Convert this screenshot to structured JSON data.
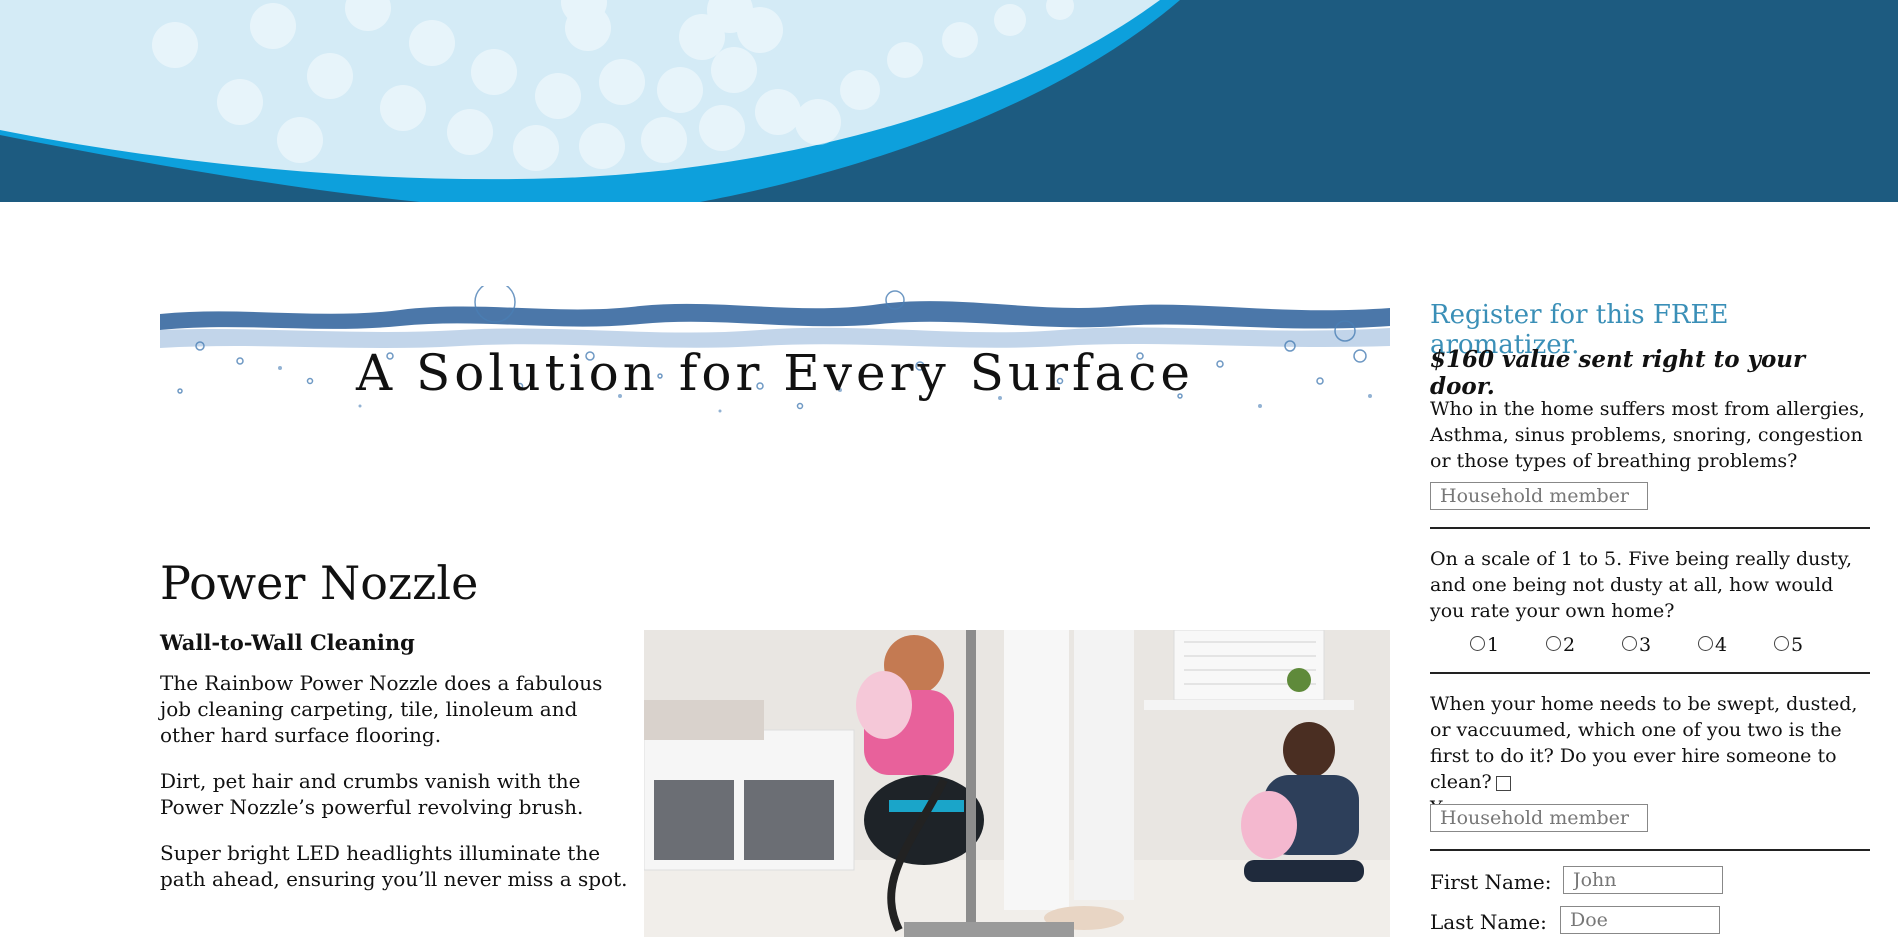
{
  "colors": {
    "header_dark": "#1d5b80",
    "header_bright": "#0da0dc",
    "header_light": "#d4ebf6",
    "heading_accent": "#3a8fb7"
  },
  "banner": {
    "title": "A Solution for Every Surface"
  },
  "product": {
    "title": "Power Nozzle",
    "subtitle": "Wall-to-Wall Cleaning",
    "paragraphs": [
      "The Rainbow Power Nozzle does a fabulous job cleaning carpeting, tile, linoleum and other hard surface flooring.",
      "Dirt, pet hair and crumbs vanish with the Power Nozzle’s powerful revolving brush.",
      "Super bright LED headlights illuminate the path ahead, ensuring you’ll never miss a spot."
    ]
  },
  "form": {
    "heading": "Register for this FREE aromatizer.",
    "subheading": "$160 value sent right to your door.",
    "q1": "Who in the home suffers most from allergies, Asthma, sinus problems, snoring, congestion or those types of breathing problems?",
    "q1_placeholder": "Household member",
    "q2": "On a scale of 1 to 5. Five being really dusty, and one being not dusty at all, how would you rate your own home?",
    "q2_options": [
      "1",
      "2",
      "3",
      "4",
      "5"
    ],
    "q3": "When your home needs to be swept, dusted, or vaccuumed, which one of you two is the first to do it? Do you ever hire someone to clean?",
    "q3_checkbox_label": "Yes",
    "q3_placeholder": "Household member",
    "first_name_label": "First Name:",
    "first_name_placeholder": "John",
    "last_name_label": "Last Name:",
    "last_name_placeholder": "Doe"
  }
}
